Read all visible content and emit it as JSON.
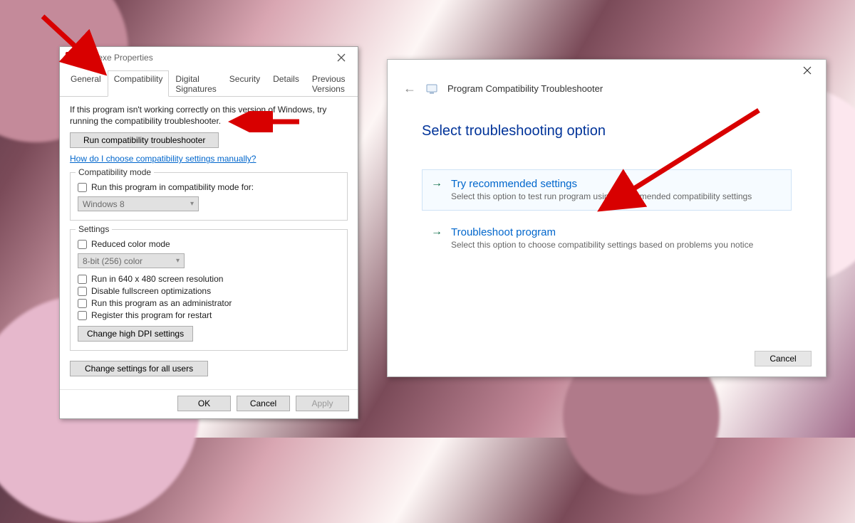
{
  "properties": {
    "title": "d32.exe Properties",
    "tabs": [
      {
        "label": "General"
      },
      {
        "label": "Compatibility"
      },
      {
        "label": "Digital Signatures"
      },
      {
        "label": "Security"
      },
      {
        "label": "Details"
      },
      {
        "label": "Previous Versions"
      }
    ],
    "active_tab_index": 1,
    "description": "If this program isn't working correctly on this version of Windows, try running the compatibility troubleshooter.",
    "run_troubleshooter_btn": "Run compatibility troubleshooter",
    "manual_link": "How do I choose compatibility settings manually?",
    "compat_mode": {
      "title": "Compatibility mode",
      "checkbox_label": "Run this program in compatibility mode for:",
      "selected_os": "Windows 8"
    },
    "settings": {
      "title": "Settings",
      "reduced_color_label": "Reduced color mode",
      "color_depth": "8-bit (256) color",
      "run_640_label": "Run in 640 x 480 screen resolution",
      "disable_fullscreen_label": "Disable fullscreen optimizations",
      "run_admin_label": "Run this program as an administrator",
      "register_restart_label": "Register this program for restart",
      "dpi_btn": "Change high DPI settings"
    },
    "all_users_btn": "Change settings for all users",
    "buttons": {
      "ok": "OK",
      "cancel": "Cancel",
      "apply": "Apply"
    }
  },
  "wizard": {
    "header_title": "Program Compatibility Troubleshooter",
    "heading": "Select troubleshooting option",
    "options": [
      {
        "title": "Try recommended settings",
        "sub": "Select this option to test run program using recommended compatibility settings"
      },
      {
        "title": "Troubleshoot program",
        "sub": "Select this option to choose compatibility settings based on problems you notice"
      }
    ],
    "cancel": "Cancel"
  },
  "colors": {
    "accent": "#0066cc",
    "heading_blue": "#003399",
    "arrow_red": "#d80000"
  }
}
